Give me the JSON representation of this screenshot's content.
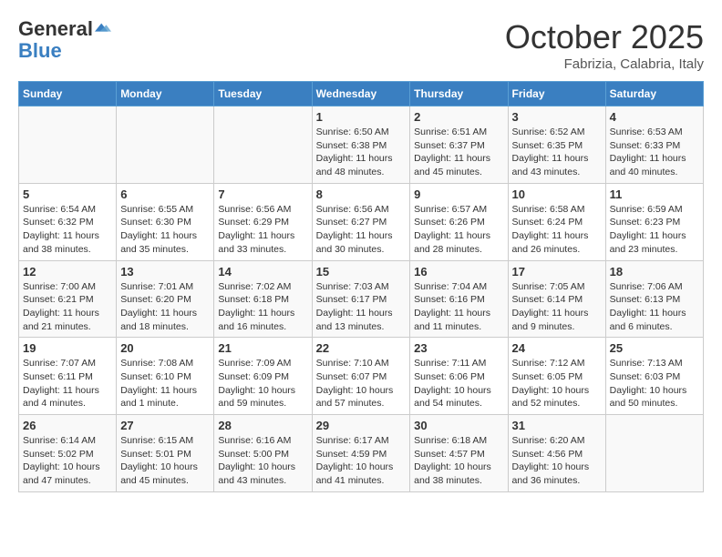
{
  "logo": {
    "line1": "General",
    "line2": "Blue"
  },
  "title": "October 2025",
  "subtitle": "Fabrizia, Calabria, Italy",
  "days_of_week": [
    "Sunday",
    "Monday",
    "Tuesday",
    "Wednesday",
    "Thursday",
    "Friday",
    "Saturday"
  ],
  "weeks": [
    [
      {
        "day": "",
        "info": ""
      },
      {
        "day": "",
        "info": ""
      },
      {
        "day": "",
        "info": ""
      },
      {
        "day": "1",
        "info": "Sunrise: 6:50 AM\nSunset: 6:38 PM\nDaylight: 11 hours and 48 minutes."
      },
      {
        "day": "2",
        "info": "Sunrise: 6:51 AM\nSunset: 6:37 PM\nDaylight: 11 hours and 45 minutes."
      },
      {
        "day": "3",
        "info": "Sunrise: 6:52 AM\nSunset: 6:35 PM\nDaylight: 11 hours and 43 minutes."
      },
      {
        "day": "4",
        "info": "Sunrise: 6:53 AM\nSunset: 6:33 PM\nDaylight: 11 hours and 40 minutes."
      }
    ],
    [
      {
        "day": "5",
        "info": "Sunrise: 6:54 AM\nSunset: 6:32 PM\nDaylight: 11 hours and 38 minutes."
      },
      {
        "day": "6",
        "info": "Sunrise: 6:55 AM\nSunset: 6:30 PM\nDaylight: 11 hours and 35 minutes."
      },
      {
        "day": "7",
        "info": "Sunrise: 6:56 AM\nSunset: 6:29 PM\nDaylight: 11 hours and 33 minutes."
      },
      {
        "day": "8",
        "info": "Sunrise: 6:56 AM\nSunset: 6:27 PM\nDaylight: 11 hours and 30 minutes."
      },
      {
        "day": "9",
        "info": "Sunrise: 6:57 AM\nSunset: 6:26 PM\nDaylight: 11 hours and 28 minutes."
      },
      {
        "day": "10",
        "info": "Sunrise: 6:58 AM\nSunset: 6:24 PM\nDaylight: 11 hours and 26 minutes."
      },
      {
        "day": "11",
        "info": "Sunrise: 6:59 AM\nSunset: 6:23 PM\nDaylight: 11 hours and 23 minutes."
      }
    ],
    [
      {
        "day": "12",
        "info": "Sunrise: 7:00 AM\nSunset: 6:21 PM\nDaylight: 11 hours and 21 minutes."
      },
      {
        "day": "13",
        "info": "Sunrise: 7:01 AM\nSunset: 6:20 PM\nDaylight: 11 hours and 18 minutes."
      },
      {
        "day": "14",
        "info": "Sunrise: 7:02 AM\nSunset: 6:18 PM\nDaylight: 11 hours and 16 minutes."
      },
      {
        "day": "15",
        "info": "Sunrise: 7:03 AM\nSunset: 6:17 PM\nDaylight: 11 hours and 13 minutes."
      },
      {
        "day": "16",
        "info": "Sunrise: 7:04 AM\nSunset: 6:16 PM\nDaylight: 11 hours and 11 minutes."
      },
      {
        "day": "17",
        "info": "Sunrise: 7:05 AM\nSunset: 6:14 PM\nDaylight: 11 hours and 9 minutes."
      },
      {
        "day": "18",
        "info": "Sunrise: 7:06 AM\nSunset: 6:13 PM\nDaylight: 11 hours and 6 minutes."
      }
    ],
    [
      {
        "day": "19",
        "info": "Sunrise: 7:07 AM\nSunset: 6:11 PM\nDaylight: 11 hours and 4 minutes."
      },
      {
        "day": "20",
        "info": "Sunrise: 7:08 AM\nSunset: 6:10 PM\nDaylight: 11 hours and 1 minute."
      },
      {
        "day": "21",
        "info": "Sunrise: 7:09 AM\nSunset: 6:09 PM\nDaylight: 10 hours and 59 minutes."
      },
      {
        "day": "22",
        "info": "Sunrise: 7:10 AM\nSunset: 6:07 PM\nDaylight: 10 hours and 57 minutes."
      },
      {
        "day": "23",
        "info": "Sunrise: 7:11 AM\nSunset: 6:06 PM\nDaylight: 10 hours and 54 minutes."
      },
      {
        "day": "24",
        "info": "Sunrise: 7:12 AM\nSunset: 6:05 PM\nDaylight: 10 hours and 52 minutes."
      },
      {
        "day": "25",
        "info": "Sunrise: 7:13 AM\nSunset: 6:03 PM\nDaylight: 10 hours and 50 minutes."
      }
    ],
    [
      {
        "day": "26",
        "info": "Sunrise: 6:14 AM\nSunset: 5:02 PM\nDaylight: 10 hours and 47 minutes."
      },
      {
        "day": "27",
        "info": "Sunrise: 6:15 AM\nSunset: 5:01 PM\nDaylight: 10 hours and 45 minutes."
      },
      {
        "day": "28",
        "info": "Sunrise: 6:16 AM\nSunset: 5:00 PM\nDaylight: 10 hours and 43 minutes."
      },
      {
        "day": "29",
        "info": "Sunrise: 6:17 AM\nSunset: 4:59 PM\nDaylight: 10 hours and 41 minutes."
      },
      {
        "day": "30",
        "info": "Sunrise: 6:18 AM\nSunset: 4:57 PM\nDaylight: 10 hours and 38 minutes."
      },
      {
        "day": "31",
        "info": "Sunrise: 6:20 AM\nSunset: 4:56 PM\nDaylight: 10 hours and 36 minutes."
      },
      {
        "day": "",
        "info": ""
      }
    ]
  ]
}
